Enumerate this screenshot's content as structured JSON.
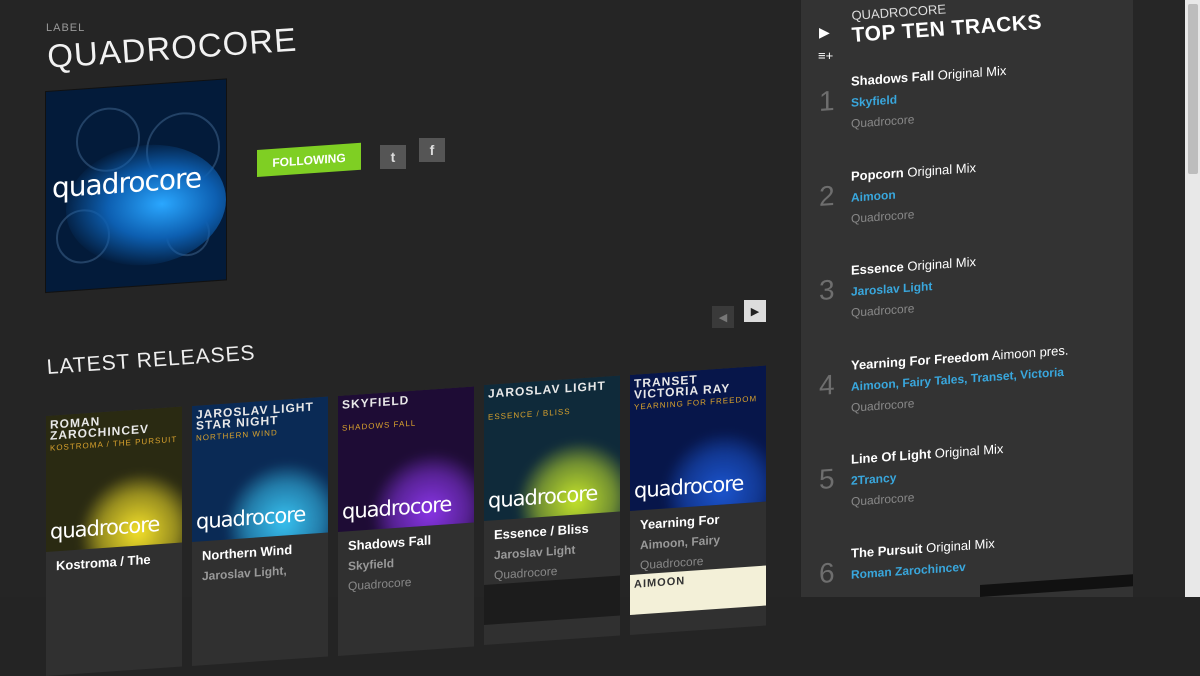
{
  "header": {
    "eyebrow": "LABEL",
    "title": "QUADROCORE"
  },
  "profile": {
    "cover_logo": "quadrocore",
    "follow_label": "FOLLOWING",
    "social": [
      {
        "name": "twitter",
        "glyph": "t"
      },
      {
        "name": "facebook",
        "glyph": "f"
      }
    ]
  },
  "releases": {
    "section_title": "LATEST RELEASES",
    "items": [
      {
        "header_line1": "ROMAN",
        "header_line2": "ZAROCHINCEV",
        "header_sub": "KOSTROMA / THE PURSUIT",
        "brand": "quadrocore",
        "title": "Kostroma / The",
        "artist": "",
        "label": "",
        "sun": "#f6e32a",
        "bg": "#2a2a12"
      },
      {
        "header_line1": "JAROSLAV LIGHT",
        "header_line2": "STAR NIGHT",
        "header_sub": "NORTHERN WIND",
        "brand": "quadrocore",
        "title": "Northern Wind",
        "artist": "Jaroslav Light,",
        "label": "",
        "sun": "#38c3f2",
        "bg": "#0a2a55"
      },
      {
        "header_line1": "SKYFIELD",
        "header_line2": "",
        "header_sub": "SHADOWS FALL",
        "brand": "quadrocore",
        "title": "Shadows Fall",
        "artist": "Skyfield",
        "label": "Quadrocore",
        "sun": "#8a35e8",
        "bg": "#1e0c35"
      },
      {
        "header_line1": "JAROSLAV LIGHT",
        "header_line2": "",
        "header_sub": "ESSENCE / BLISS",
        "brand": "quadrocore",
        "title": "Essence / Bliss",
        "artist": "Jaroslav Light",
        "label": "Quadrocore",
        "sun": "#c6e62a",
        "bg": "#0f2a3a"
      },
      {
        "header_line1": "TRANSET",
        "header_line2": "VICTORIA RAY",
        "header_sub": "YEARNING FOR FREEDOM",
        "brand": "quadrocore",
        "title": "Yearning For",
        "artist": "Aimoon, Fairy",
        "label": "Quadrocore",
        "sun": "#1b55d0",
        "bg": "#07164a"
      }
    ],
    "next_row": [
      {
        "header": ""
      },
      {
        "header": "AIMOON"
      }
    ]
  },
  "sidebar": {
    "label_name": "QUADROCORE",
    "title": "TOP TEN TRACKS",
    "tracks": [
      {
        "num": "1",
        "name": "Shadows Fall",
        "mix": "Original Mix",
        "artists": "Skyfield",
        "label": "Quadrocore"
      },
      {
        "num": "2",
        "name": "Popcorn",
        "mix": "Original Mix",
        "artists": "Aimoon",
        "label": "Quadrocore"
      },
      {
        "num": "3",
        "name": "Essence",
        "mix": "Original Mix",
        "artists": "Jaroslav Light",
        "label": "Quadrocore"
      },
      {
        "num": "4",
        "name": "Yearning For Freedom",
        "mix": "Aimoon pres.",
        "artists": "Aimoon, Fairy Tales, Transet, Victoria",
        "label": "Quadrocore"
      },
      {
        "num": "5",
        "name": "Line Of Light",
        "mix": "Original Mix",
        "artists": "2Trancy",
        "label": "Quadrocore"
      },
      {
        "num": "6",
        "name": "The Pursuit",
        "mix": "Original Mix",
        "artists": "Roman Zarochincev",
        "label": ""
      }
    ]
  },
  "colors": {
    "accent_green": "#7fcf23",
    "artist_blue": "#39a7dd",
    "panel": "#333333"
  }
}
